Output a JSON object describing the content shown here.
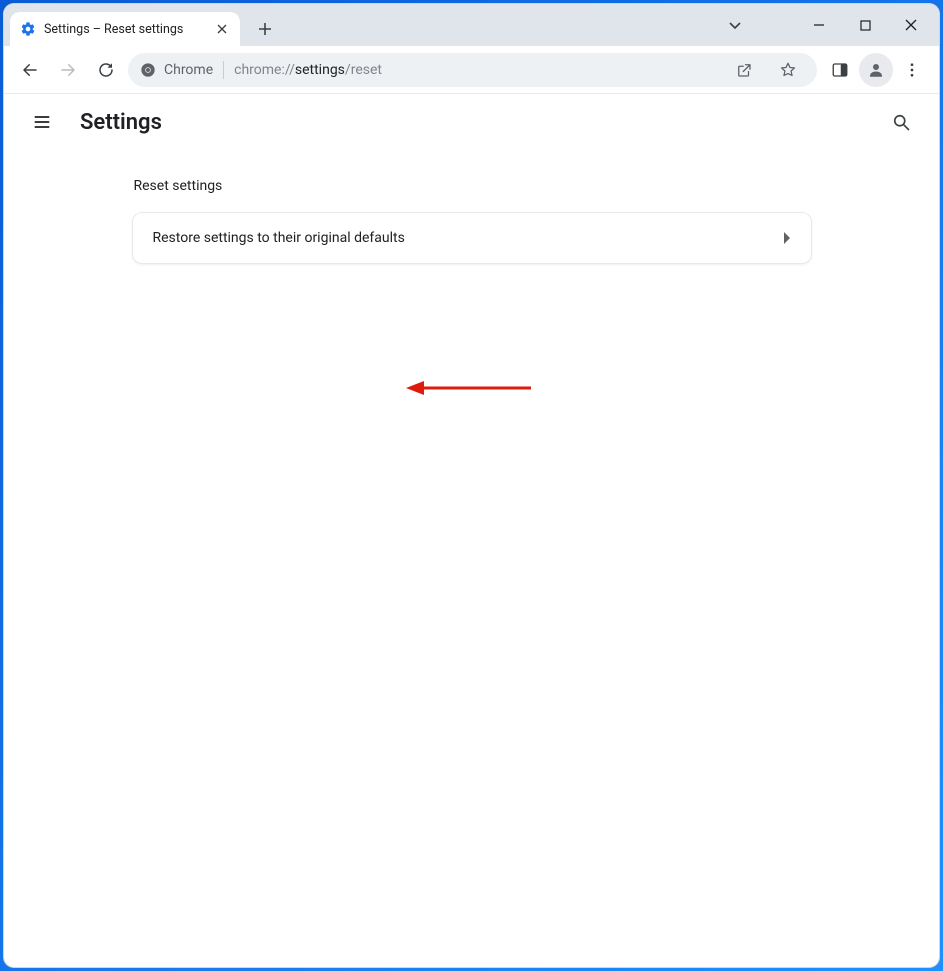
{
  "tab": {
    "title": "Settings – Reset settings"
  },
  "omnibox": {
    "chip": "Chrome",
    "url_dim1": "chrome://",
    "url_strong": "settings",
    "url_dim2": "/reset"
  },
  "app": {
    "title": "Settings"
  },
  "section": {
    "heading": "Reset settings",
    "row_label": "Restore settings to their original defaults"
  },
  "colors": {
    "annotation": "#e11b0c",
    "accent": "#1a73e8"
  }
}
